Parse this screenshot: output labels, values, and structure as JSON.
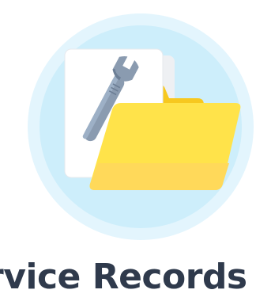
{
  "caption": {
    "title": "rvice Records I"
  },
  "illustration": {
    "icons": {
      "circle": "halo-circle",
      "document": "document-icon",
      "wrench": "wrench-icon",
      "folder": "folder-icon"
    }
  },
  "colors": {
    "halo_outer": "#e3f5fd",
    "halo_inner": "#cdeefb",
    "paper": "#ffffff",
    "paper_back": "#eef0f3",
    "wrench": "#8a9bb0",
    "wrench_shade": "#6c7e95",
    "folder_back": "#f7c81f",
    "folder_front": "#ffe34a",
    "folder_bottom": "#ffd95a",
    "text": "#2f3a4c"
  }
}
